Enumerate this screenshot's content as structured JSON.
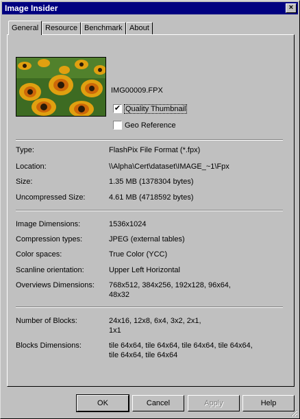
{
  "window": {
    "title": "Image Insider",
    "close_glyph": "×"
  },
  "tabs": [
    {
      "label": "General",
      "active": true
    },
    {
      "label": "Resource",
      "active": false
    },
    {
      "label": "Benchmark",
      "active": false
    },
    {
      "label": "About",
      "active": false
    }
  ],
  "general": {
    "filename": "IMG00009.FPX",
    "quality_thumbnail": {
      "label": "Quality Thumbnail",
      "checked": true,
      "check_glyph": "✔"
    },
    "geo_reference": {
      "label": "Geo Reference",
      "checked": false
    },
    "thumbnail_icon": "flowers-thumbnail-image",
    "file": {
      "type_label": "Type:",
      "type_value": "FlashPix File Format (*.fpx)",
      "location_label": "Location:",
      "location_value": "\\\\Alpha\\Cert\\dataset\\IMAGE_~1\\Fpx",
      "size_label": "Size:",
      "size_value": "1.35 MB (1378304 bytes)",
      "uncompressed_label": "Uncompressed Size:",
      "uncompressed_value": "4.61 MB (4718592 bytes)"
    },
    "image": {
      "dimensions_label": "Image Dimensions:",
      "dimensions_value": "1536x1024",
      "compression_label": "Compression types:",
      "compression_value": "JPEG (external tables)",
      "color_label": "Color spaces:",
      "color_value": "True Color (YCC)",
      "scanline_label": "Scanline orientation:",
      "scanline_value": "Upper Left Horizontal",
      "overviews_label": "Overviews Dimensions:",
      "overviews_value_line1": "768x512, 384x256, 192x128, 96x64,",
      "overviews_value_line2": "48x32"
    },
    "blocks": {
      "count_label": "Number of Blocks:",
      "count_value_line1": "24x16, 12x8, 6x4, 3x2, 2x1,",
      "count_value_line2": "1x1",
      "dims_label": "Blocks Dimensions:",
      "dims_value_line1": "tile 64x64, tile 64x64, tile 64x64, tile 64x64,",
      "dims_value_line2": "tile 64x64, tile 64x64"
    }
  },
  "buttons": {
    "ok": "OK",
    "cancel": "Cancel",
    "apply": "Apply",
    "help": "Help",
    "apply_enabled": false
  },
  "colors": {
    "titlebar": "#000080",
    "face": "#c0c0c0"
  }
}
